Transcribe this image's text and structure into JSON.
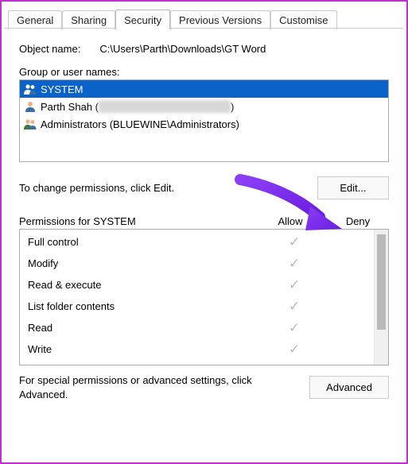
{
  "tabs": {
    "general": "General",
    "sharing": "Sharing",
    "security": "Security",
    "previous": "Previous Versions",
    "customise": "Customise"
  },
  "objectName": {
    "label": "Object name:",
    "value": "C:\\Users\\Parth\\Downloads\\GT Word"
  },
  "groupLabel": "Group or user names:",
  "users": [
    {
      "name": "SYSTEM",
      "icon": "group-icon",
      "selected": true
    },
    {
      "name": "Parth Shah (",
      "icon": "user-icon",
      "selected": false,
      "redacted": true,
      "suffix": ")"
    },
    {
      "name": "Administrators (BLUEWINE\\Administrators)",
      "icon": "group-icon",
      "selected": false
    }
  ],
  "editHint": "To change permissions, click Edit.",
  "editButton": "Edit...",
  "permHeader": {
    "title": "Permissions for SYSTEM",
    "allow": "Allow",
    "deny": "Deny"
  },
  "permissions": [
    {
      "name": "Full control",
      "allow": true,
      "deny": false
    },
    {
      "name": "Modify",
      "allow": true,
      "deny": false
    },
    {
      "name": "Read & execute",
      "allow": true,
      "deny": false
    },
    {
      "name": "List folder contents",
      "allow": true,
      "deny": false
    },
    {
      "name": "Read",
      "allow": true,
      "deny": false
    },
    {
      "name": "Write",
      "allow": true,
      "deny": false
    }
  ],
  "advancedHint": "For special permissions or advanced settings, click Advanced.",
  "advancedButton": "Advanced",
  "annotation": {
    "arrowColor": "#7b2ff2"
  }
}
